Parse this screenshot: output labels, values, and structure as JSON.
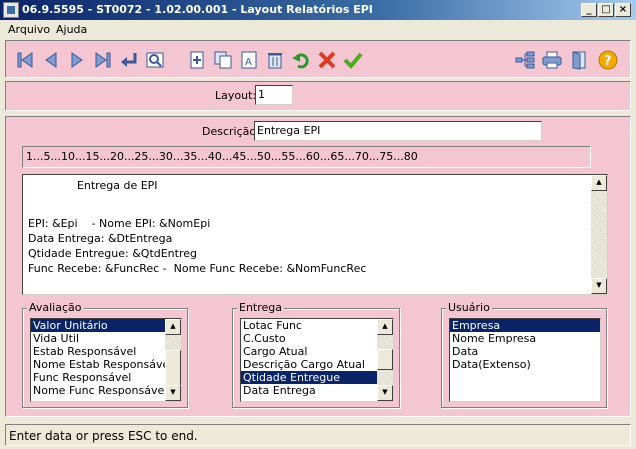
{
  "window": {
    "title": "06.9.5595 - ST0072 - 1.02.00.001 - Layout Relatórios EPI"
  },
  "menu": {
    "arquivo": "Arquivo",
    "ajuda": "Ajuda"
  },
  "layout": {
    "label": "Layout:",
    "value": "1"
  },
  "descricao": {
    "label": "Descrição:",
    "value": "Entrega EPI"
  },
  "ruler": "1...5...10...15...20...25...30...35...40...45...50...55...60...65...70...75...80",
  "editor": {
    "lines": [
      "              Entrega de EPI",
      "",
      "EPI: &Epi    - Nome EPI: &NomEpi",
      "Data Entrega: &DtEntrega",
      "Qtidade Entregue: &QtdEntreg",
      "Func Recebe: &FuncRec -  Nome Func Recebe: &NomFuncRec"
    ]
  },
  "groups": {
    "avaliacao": {
      "title": "Avaliação",
      "items": [
        "Valor Unitário",
        "Vida Util",
        "Estab Responsável",
        "Nome Estab Responsável",
        "Func Responsável",
        "Nome Func Responsável"
      ],
      "selected": 0
    },
    "entrega": {
      "title": "Entrega",
      "items": [
        "Lotac Func",
        "C.Custo",
        "Cargo Atual",
        "Descrição Cargo Atual",
        "Qtidade Entregue",
        "Data Entrega"
      ],
      "selected": 4
    },
    "usuario": {
      "title": "Usuário",
      "items": [
        "Empresa",
        "Nome Empresa",
        "Data",
        "Data(Extenso)"
      ],
      "selected": 0
    }
  },
  "status": "Enter data or press ESC to end."
}
